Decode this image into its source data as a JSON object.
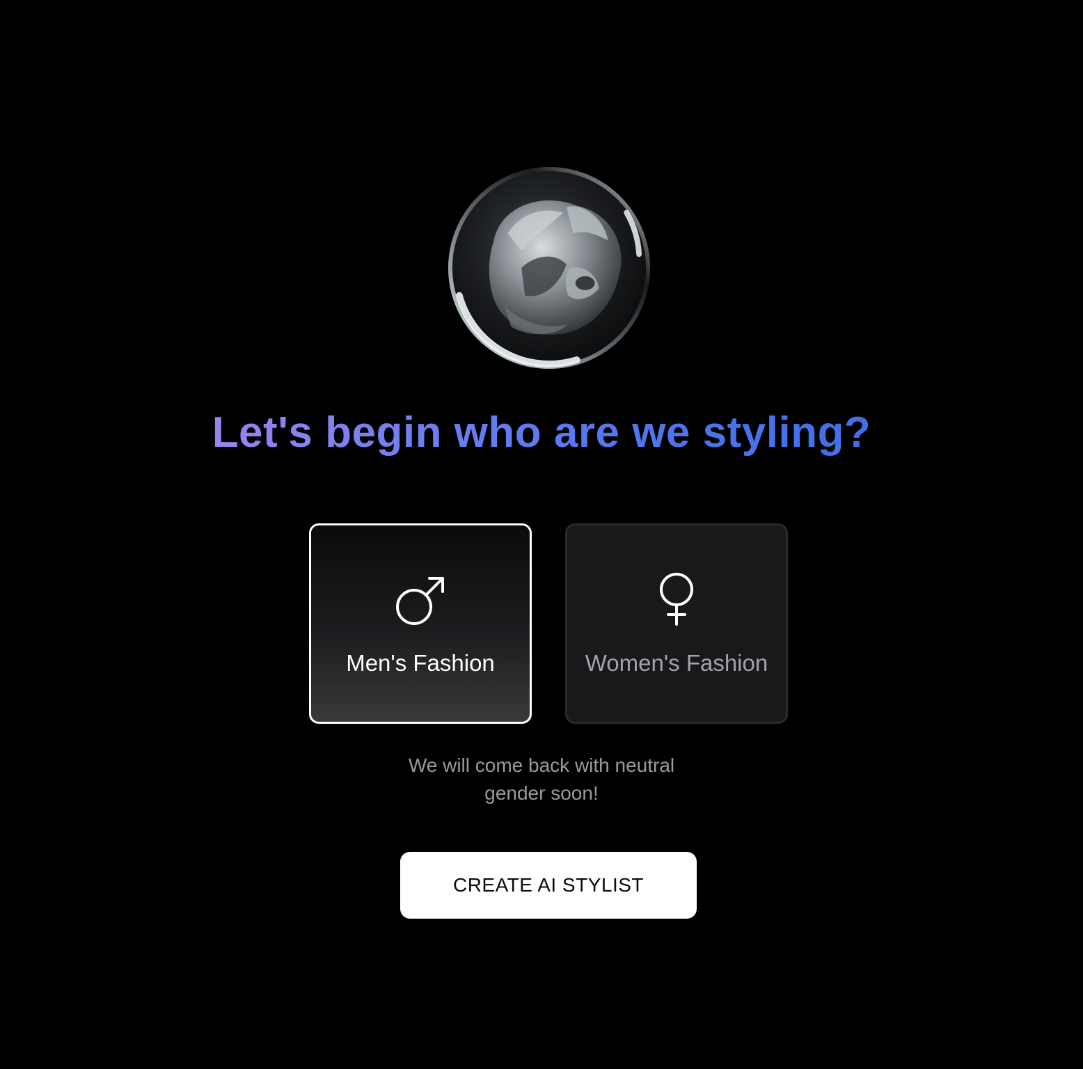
{
  "hero": {
    "image": "abstract-3d-sculpture-orb"
  },
  "headline": "Let's begin who are we styling?",
  "options": [
    {
      "label": "Men's Fashion",
      "icon": "male-symbol-icon",
      "selected": true
    },
    {
      "label": "Women's Fashion",
      "icon": "female-symbol-icon",
      "selected": false
    }
  ],
  "note": "We will come back with neutral gender soon!",
  "cta": {
    "label": "CREATE AI STYLIST"
  },
  "colors": {
    "background": "#000000",
    "headline_gradient_start": "#9a84f0",
    "headline_gradient_end": "#3f6fe6",
    "selected_border": "#ffffff",
    "cta_background": "#ffffff"
  }
}
